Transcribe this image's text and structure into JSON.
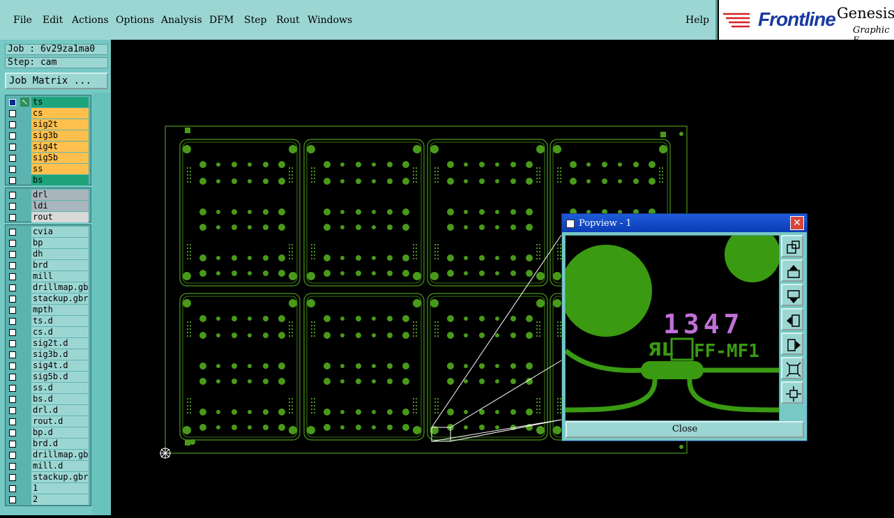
{
  "menu": {
    "items": [
      {
        "label": "File",
        "u": "F"
      },
      {
        "label": "Edit",
        "u": "E"
      },
      {
        "label": "Actions",
        "u": "A"
      },
      {
        "label": "Options",
        "u": "O"
      },
      {
        "label": "Analysis",
        "u": ""
      },
      {
        "label": "DFM",
        "u": ""
      },
      {
        "label": "Step",
        "u": "S"
      },
      {
        "label": "Rout",
        "u": "R"
      },
      {
        "label": "Windows",
        "u": "W"
      }
    ],
    "help": "Help"
  },
  "logo": {
    "brand": "Frontline",
    "product": "Genesis",
    "subtitle": "Graphic E"
  },
  "job": {
    "job_label": "Job : 6v29za1ma0",
    "step_label": "Step: cam",
    "matrix_button": "Job Matrix ..."
  },
  "layers": {
    "board": [
      {
        "name": "ts",
        "color": "#1fa37a",
        "checked": true,
        "active": true
      },
      {
        "name": "cs",
        "color": "#ffc04d",
        "checked": false
      },
      {
        "name": "sig2t",
        "color": "#ffc04d",
        "checked": false
      },
      {
        "name": "sig3b",
        "color": "#ffc04d",
        "checked": false
      },
      {
        "name": "sig4t",
        "color": "#ffc04d",
        "checked": false
      },
      {
        "name": "sig5b",
        "color": "#ffc04d",
        "checked": false
      },
      {
        "name": "ss",
        "color": "#ffc04d",
        "checked": false
      },
      {
        "name": "bs",
        "color": "#1fa37a",
        "checked": false
      }
    ],
    "drill": [
      {
        "name": "drl",
        "color": "#a9b6bd",
        "checked": false
      },
      {
        "name": "ldi",
        "color": "#a9b6bd",
        "checked": false
      },
      {
        "name": "rout",
        "color": "#d9d9d9",
        "checked": false
      }
    ],
    "misc": [
      {
        "name": "cvia"
      },
      {
        "name": "bp"
      },
      {
        "name": "dh"
      },
      {
        "name": "brd"
      },
      {
        "name": "mill"
      },
      {
        "name": "drillmap.gbr"
      },
      {
        "name": "stackup.gbr"
      },
      {
        "name": "mpth"
      },
      {
        "name": "ts.d"
      },
      {
        "name": "cs.d"
      },
      {
        "name": "sig2t.d"
      },
      {
        "name": "sig3b.d"
      },
      {
        "name": "sig4t.d"
      },
      {
        "name": "sig5b.d"
      },
      {
        "name": "ss.d"
      },
      {
        "name": "bs.d"
      },
      {
        "name": "drl.d"
      },
      {
        "name": "rout.d"
      },
      {
        "name": "bp.d"
      },
      {
        "name": "brd.d"
      },
      {
        "name": "drillmap.gbr"
      },
      {
        "name": "mill.d"
      },
      {
        "name": "stackup.gbr"
      },
      {
        "name": "1"
      },
      {
        "name": "2"
      }
    ],
    "misc_color": "#9cd6d3"
  },
  "board_colors": {
    "copper": "#4a9a1a",
    "outline": "#4a9a1a",
    "background": "#000000"
  },
  "popview": {
    "title": "Popview - 1",
    "close_label": "Close",
    "close_x": "✕",
    "silk_number": "1347",
    "silk_text": "FF-MF1",
    "silk_color": "#c070d8",
    "copper_color": "#3a9a12",
    "tools": [
      "zoom-window-icon",
      "pan-up-icon",
      "pan-down-icon",
      "pan-left-icon",
      "pan-right-icon",
      "zoom-fit-icon",
      "zoom-out-icon"
    ]
  }
}
